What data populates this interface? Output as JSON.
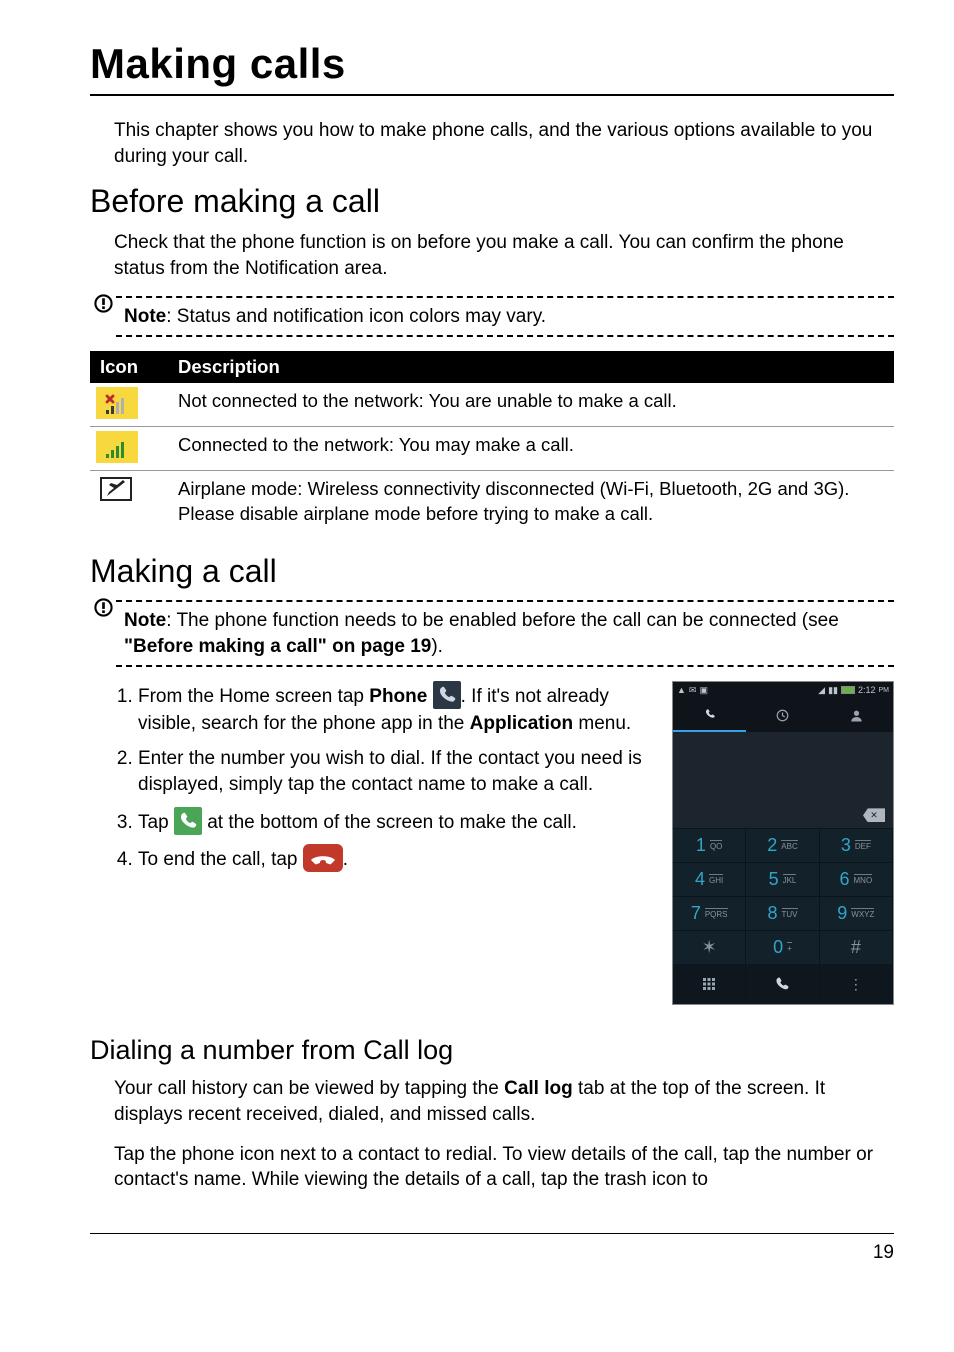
{
  "headings": {
    "h1": "Making calls",
    "h2a": "Before making a call",
    "h2b": "Making a call",
    "h3": "Dialing a number from Call log"
  },
  "intro": "This chapter shows you how to make phone calls, and the various options available to you during your call.",
  "before_text": "Check that the phone function is on before you make a call. You can confirm the phone status from the Notification area.",
  "note1": {
    "label": "Note",
    "text": ": Status and notification icon colors may vary."
  },
  "table": {
    "head_icon": "Icon",
    "head_desc": "Description",
    "rows": [
      {
        "desc": "Not connected to the network: You are unable to make a call."
      },
      {
        "desc": "Connected to the network: You may make a call."
      },
      {
        "desc": "Airplane mode: Wireless connectivity disconnected (Wi-Fi, Bluetooth, 2G and 3G). Please disable airplane mode before trying to make a call."
      }
    ]
  },
  "note2": {
    "label": "Note",
    "t1": ": The phone function needs to be enabled before the call can be connected (see ",
    "link": "\"Before making a call\" on page 19",
    "t2": ")."
  },
  "steps": {
    "s1a": "From the Home screen tap ",
    "s1b": "Phone",
    "s1c": ". If it's not already visible, search for the phone app in the ",
    "s1d": "Application",
    "s1e": " menu.",
    "s2": "Enter the number you wish to dial. If the contact you need is displayed, simply tap the contact name to make a call.",
    "s3a": "Tap ",
    "s3b": " at the bottom of the screen to make the call.",
    "s4a": "To end the call, tap ",
    "s4b": "."
  },
  "phone": {
    "time": "2:12",
    "pm": "PM",
    "keys": [
      {
        "n": "1",
        "l": "QO"
      },
      {
        "n": "2",
        "l": "ABC"
      },
      {
        "n": "3",
        "l": "DEF"
      },
      {
        "n": "4",
        "l": "GHI"
      },
      {
        "n": "5",
        "l": "JKL"
      },
      {
        "n": "6",
        "l": "MNO"
      },
      {
        "n": "7",
        "l": "PQRS"
      },
      {
        "n": "8",
        "l": "TUV"
      },
      {
        "n": "9",
        "l": "WXYZ"
      },
      {
        "n": "✶",
        "l": ""
      },
      {
        "n": "0",
        "l": "+"
      },
      {
        "n": "#",
        "l": ""
      }
    ]
  },
  "dialing": {
    "p1a": "Your call history can be viewed by tapping the ",
    "p1b": "Call log",
    "p1c": " tab at the top of the screen. It displays recent received, dialed, and missed calls.",
    "p2": "Tap the phone icon next to a contact to redial. To view details of the call, tap the number or contact's name. While viewing the details of a call, tap the trash icon to"
  },
  "page_number": "19"
}
